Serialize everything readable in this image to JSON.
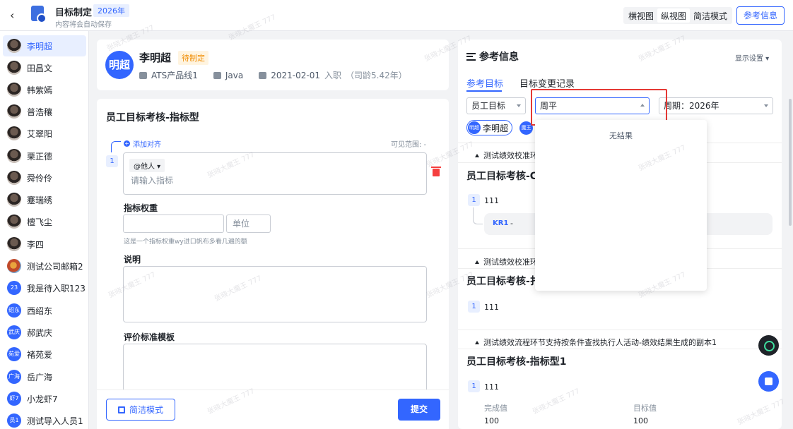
{
  "header": {
    "back_icon": "chevron-left-icon",
    "title": "目标制定",
    "year_badge": "2026年",
    "autosave": "内容将会自动保存",
    "views": [
      "横视图",
      "纵视图",
      "简洁模式"
    ],
    "reference_button": "参考信息"
  },
  "sidebar": {
    "items": [
      {
        "name": "李明超",
        "avatar_text": ""
      },
      {
        "name": "田昌文",
        "avatar_text": ""
      },
      {
        "name": "韩紫嫣",
        "avatar_text": ""
      },
      {
        "name": "普浩穰",
        "avatar_text": ""
      },
      {
        "name": "艾翠阳",
        "avatar_text": ""
      },
      {
        "name": "栗正德",
        "avatar_text": ""
      },
      {
        "name": "舜伶伶",
        "avatar_text": ""
      },
      {
        "name": "蹇瑞绣",
        "avatar_text": ""
      },
      {
        "name": "檀飞尘",
        "avatar_text": ""
      },
      {
        "name": "李四",
        "avatar_text": ""
      },
      {
        "name": "测试公司邮箱2",
        "avatar_text": ""
      },
      {
        "name": "我是待入职123",
        "avatar_text": "23"
      },
      {
        "name": "西绍东",
        "avatar_text": "绍东"
      },
      {
        "name": "郝武庆",
        "avatar_text": "武庆"
      },
      {
        "name": "褚苑爱",
        "avatar_text": "苑爱"
      },
      {
        "name": "岳广海",
        "avatar_text": "广海"
      },
      {
        "name": "小龙虾7",
        "avatar_text": "虾7"
      },
      {
        "name": "测试导入人员1",
        "avatar_text": "员1"
      }
    ]
  },
  "profile": {
    "avatar_text": "明超",
    "name": "李明超",
    "status": "待制定",
    "department": "ATS产品线1",
    "position": "Java",
    "join_date": "2021-02-01",
    "join_suffix": "入职",
    "tenure": "（司龄5.42年）"
  },
  "form": {
    "title": "员工目标考核-指标型",
    "add_align": "添加对齐",
    "visible_range": "可见范围: -",
    "item_number": "1",
    "at_others": "@他人",
    "indicator_placeholder": "请输入指标",
    "weight_label": "指标权重",
    "unit_placeholder": "单位",
    "weight_hint": "这是一个指标权重wy进口帆布多看几遍的额",
    "desc_label": "说明",
    "criteria_label": "评价标准模板",
    "simple_mode_button": "简洁模式",
    "submit_button": "提交"
  },
  "reference": {
    "title": "参考信息",
    "display_settings": "显示设置",
    "tabs": [
      "参考目标",
      "目标变更记录"
    ],
    "filter_type": "员工目标",
    "filter_search": "周平",
    "filter_period": "周期：2026年",
    "chip_person": "李明超",
    "chip_person_avatar": "明超",
    "chip_other_avatar": "魔王",
    "dropdown_empty": "无结果",
    "sections": [
      {
        "head": "测试绩效校准环",
        "title": "员工目标考核-C",
        "rows": [
          {
            "num": "1",
            "value": "111"
          }
        ],
        "kr_label": "KR1",
        "kr_value": "-"
      },
      {
        "head": "测试绩效校准环",
        "title": "员工目标考核-扌",
        "rows": [
          {
            "num": "1",
            "value": "111"
          }
        ]
      },
      {
        "head": "测试绩效流程环节支持按条件查找执行人活动-绩效结果生成的副本1",
        "title": "员工目标考核-指标型1",
        "rows": [
          {
            "num": "1",
            "value": "111"
          }
        ]
      }
    ],
    "completion_label": "完成值",
    "target_label": "目标值",
    "completion_value": "100",
    "target_value": "100"
  },
  "watermark": "张晓大魔王 777",
  "colors": {
    "accent": "#3366ff",
    "status": "#f08c00",
    "highlight": "#e53935",
    "danger": "#f53f3f"
  }
}
